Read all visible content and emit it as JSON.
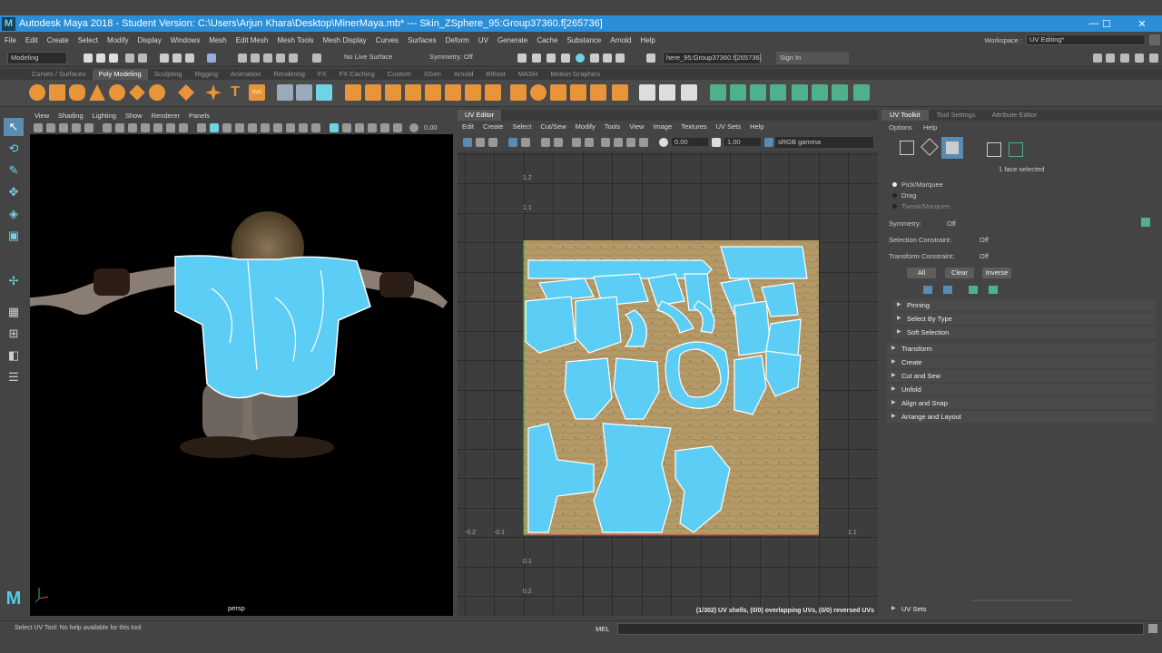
{
  "titlebar": {
    "text": "Autodesk Maya 2018 - Student Version: C:\\Users\\Arjun Khara\\Desktop\\MinerMaya.mb*  ---  Skin_ZSphere_95:Group37360.f[265736]",
    "logo": "M",
    "minimize": "—",
    "maximize": "☐",
    "close": "✕"
  },
  "menubar": {
    "items": [
      "File",
      "Edit",
      "Create",
      "Select",
      "Modify",
      "Display",
      "Windows",
      "Mesh",
      "Edit Mesh",
      "Mesh Tools",
      "Mesh Display",
      "Curves",
      "Surfaces",
      "Deform",
      "UV",
      "Generate",
      "Cache",
      "Substance",
      "Arnold",
      "Help"
    ],
    "workspace_label": "Workspace :",
    "workspace_value": "UV Editing*"
  },
  "statusline": {
    "mode": "Modeling",
    "live_surface": "No Live Surface",
    "symmetry": "Symmetry: Off",
    "selection_field": "here_95:Group37360.f[265736]",
    "sign_in": "Sign In"
  },
  "shelf": {
    "tabs": [
      "Curves / Surfaces",
      "Poly Modeling",
      "Sculpting",
      "Rigging",
      "Animation",
      "Rendering",
      "FX",
      "FX Caching",
      "Custom",
      "XGen",
      "Arnold",
      "Bifrost",
      "MASH",
      "Motion Graphics"
    ],
    "active_tab": 1
  },
  "viewport": {
    "menu": [
      "View",
      "Shading",
      "Lighting",
      "Show",
      "Renderer",
      "Panels"
    ],
    "field_value": "0.00",
    "camera_label": "persp"
  },
  "uveditor": {
    "tab": "UV Editor",
    "menu": [
      "Edit",
      "Create",
      "Select",
      "Cut/Sew",
      "Modify",
      "Tools",
      "View",
      "Image",
      "Textures",
      "UV Sets",
      "Help"
    ],
    "val1": "0.00",
    "val2": "1.00",
    "colorspace": "sRGB gamma",
    "ticks_v": [
      "1.2",
      "1.1",
      "0.1",
      "0.2"
    ],
    "ticks_h": [
      "-0.2",
      "-0.1",
      "1.1"
    ],
    "status": "(1/302) UV shells, (0/0) overlapping UVs, (0/0) reversed UVs"
  },
  "toolkit": {
    "tabs": [
      "UV Toolkit",
      "Tool Settings",
      "Attribute Editor"
    ],
    "submenu": [
      "Options",
      "Help"
    ],
    "face_selected": "1 face selected",
    "modes": [
      "Pick/Marquee",
      "Drag",
      "Tweak/Marquee"
    ],
    "symmetry_label": "Symmetry:",
    "symmetry_value": "Off",
    "sel_constraint_label": "Selection Constraint:",
    "sel_constraint_value": "Off",
    "xf_constraint_label": "Transform Constraint:",
    "xf_constraint_value": "Off",
    "buttons": [
      "All",
      "Clear",
      "Inverse"
    ],
    "subsections": [
      "Pinning",
      "Select By Type",
      "Soft Selection"
    ],
    "sections": [
      "Transform",
      "Create",
      "Cut and Sew",
      "Unfold",
      "Align and Snap",
      "Arrange and Layout"
    ],
    "uvsets": "UV Sets"
  },
  "helpline": {
    "text": "Select UV Tool: No help available for this tool",
    "mel": "MEL"
  },
  "colors": {
    "accent": "#2a8fd8",
    "uv_blue": "#5ccdf5",
    "shelf_orange": "#e8953a",
    "shelf_green": "#4fb08c"
  }
}
